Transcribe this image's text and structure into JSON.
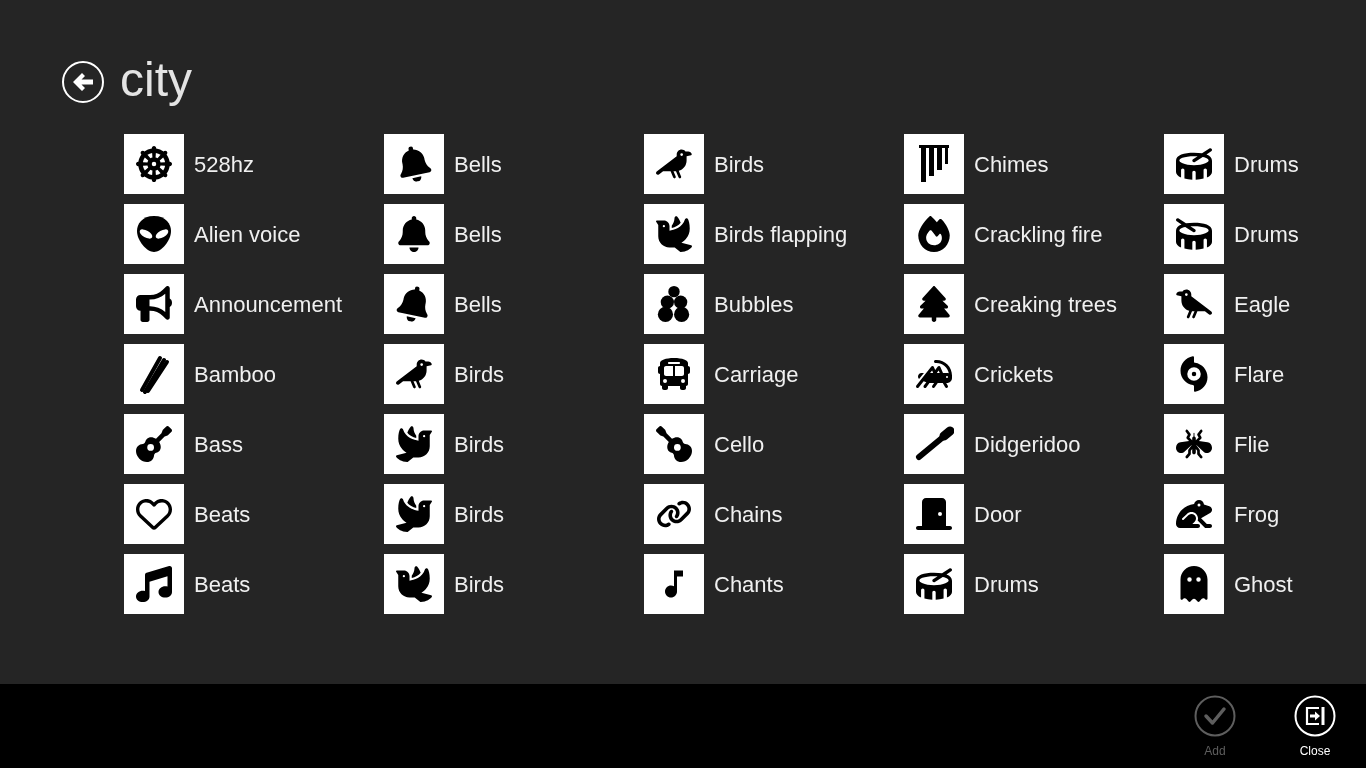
{
  "header": {
    "title": "city"
  },
  "sounds": [
    "528hz",
    "Alien voice",
    "Announcement",
    "Bamboo",
    "Bass",
    "Beats",
    "Beats",
    "Bells",
    "Bells",
    "Bells",
    "Birds",
    "Birds",
    "Birds",
    "Birds",
    "Birds",
    "Birds flapping",
    "Bubbles",
    "Carriage",
    "Cello",
    "Chains",
    "Chants",
    "Chimes",
    "Crackling fire",
    "Creaking trees",
    "Crickets",
    "Didgeridoo",
    "Door",
    "Drums",
    "Drums",
    "Drums",
    "Eagle",
    "Flare",
    "Flie",
    "Frog",
    "Ghost"
  ],
  "app_bar": {
    "buttons": [
      {
        "label": "Add",
        "disabled": true
      },
      {
        "label": "Close",
        "disabled": false
      }
    ]
  }
}
